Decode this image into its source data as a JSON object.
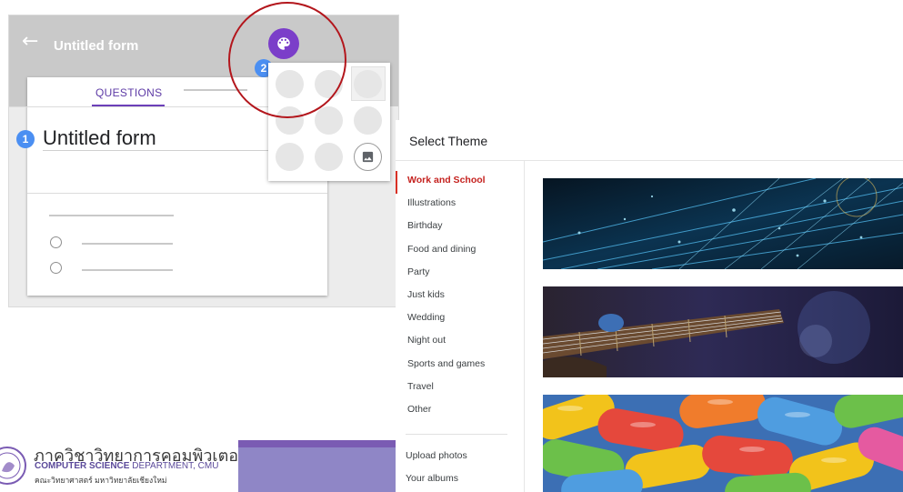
{
  "forms": {
    "header_title": "Untitled form",
    "tab_questions": "QUESTIONS",
    "form_title": "Untitled form",
    "step_badges": [
      "1",
      "2"
    ],
    "back_icon": "arrow-left-icon",
    "palette_icon": "palette-icon",
    "image_icon": "image-icon",
    "accent_color": "#7b3ec9",
    "highlight_color": "#b3161c"
  },
  "theme_dialog": {
    "title": "Select Theme",
    "categories": [
      "Work and School",
      "Illustrations",
      "Birthday",
      "Food and dining",
      "Party",
      "Just kids",
      "Wedding",
      "Night out",
      "Sports and games",
      "Travel",
      "Other"
    ],
    "active_category": "Work and School",
    "upload_photos": "Upload photos",
    "your_albums": "Your albums",
    "active_color": "#d93025"
  },
  "department": {
    "thai_name": "ภาควิชาวิทยาการคอมพิวเตอร์",
    "en_bold": "COMPUTER SCIENCE",
    "en_rest": " DEPARTMENT, CMU",
    "faculty": "คณะวิทยาศาสตร์ มหาวิทยาลัยเชียงใหม่",
    "bar_color": "#8f86c6"
  }
}
